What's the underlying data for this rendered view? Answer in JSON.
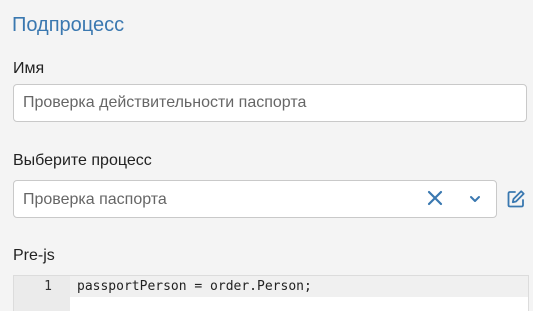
{
  "subprocess": {
    "title": "Подпроцесс",
    "name_label": "Имя",
    "name_value": "Проверка действительности паспорта",
    "process_label": "Выберите процесс",
    "process_value": "Проверка паспорта",
    "prejs_label": "Pre-js",
    "code": {
      "lines": [
        {
          "number": "1",
          "text": "passportPerson = order.Person;"
        }
      ]
    }
  },
  "icons": {
    "clear": "close-icon",
    "dropdown": "chevron-down-icon",
    "edit": "edit-icon"
  },
  "colors": {
    "title": "#3a78b0",
    "icon": "#3a78b0"
  }
}
